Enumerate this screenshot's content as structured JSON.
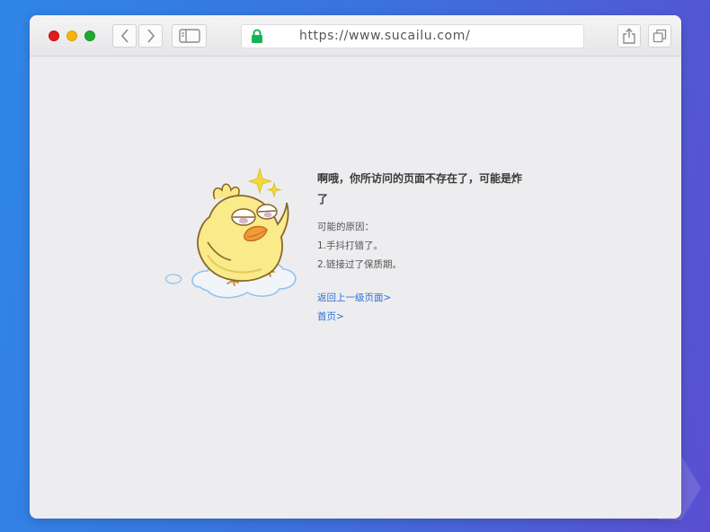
{
  "browser": {
    "url": "https://www.sucailu.com/"
  },
  "error": {
    "title": "啊哦，你所访问的页面不存在了，可能是炸了",
    "reasons_heading": "可能的原因：",
    "reasons": [
      "1.手抖打错了。",
      "2.链接过了保质期。"
    ],
    "links": {
      "back": "返回上一级页面>",
      "home": "首页>"
    }
  },
  "icons": [
    "close-dot",
    "minimize-dot",
    "zoom-dot",
    "back-arrow-icon",
    "forward-arrow-icon",
    "sidebar-icon",
    "lock-icon",
    "share-icon",
    "tabs-icon",
    "chick-mascot-icon"
  ],
  "colors": {
    "background_start": "#2f86e6",
    "background_end": "#5a4fd1",
    "window_bg": "#ededf0",
    "lock": "#17b455",
    "link": "#2c6fd6"
  }
}
